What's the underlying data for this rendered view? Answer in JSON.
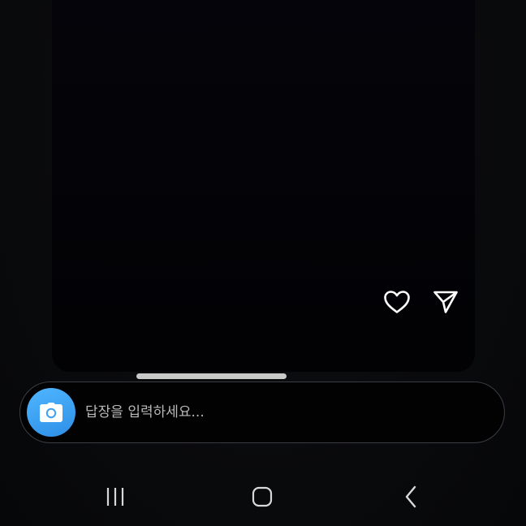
{
  "story": {
    "actions": [
      {
        "icon": "heart-icon"
      },
      {
        "icon": "send-icon"
      }
    ]
  },
  "reply": {
    "placeholder": "답장을 입력하세요...",
    "camera_icon": "camera-icon",
    "accent_color": "#3aa0f5"
  },
  "navigation": {
    "buttons": [
      {
        "icon": "recent-apps-icon"
      },
      {
        "icon": "home-icon"
      },
      {
        "icon": "back-icon"
      }
    ]
  }
}
